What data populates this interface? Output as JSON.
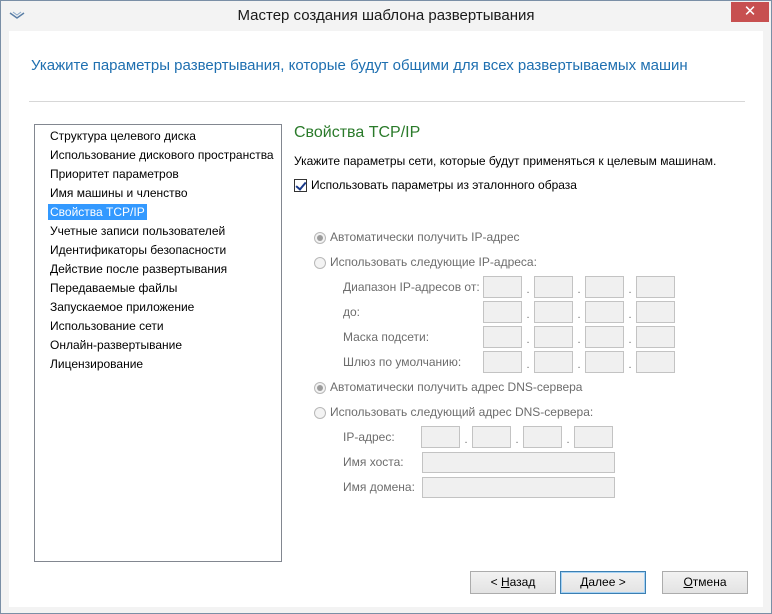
{
  "window": {
    "title": "Мастер создания шаблона развертывания",
    "close_label": "✕"
  },
  "header": {
    "text": "Укажите параметры развертывания, которые будут общими для всех развертываемых машин"
  },
  "nav": {
    "selected_index": 4,
    "items": [
      {
        "label": "Структура целевого диска"
      },
      {
        "label": "Использование дискового пространства"
      },
      {
        "label": "Приоритет параметров"
      },
      {
        "label": "Имя машины и членство"
      },
      {
        "label": "Свойства TCP/IP"
      },
      {
        "label": "Учетные записи пользователей"
      },
      {
        "label": "Идентификаторы безопасности"
      },
      {
        "label": "Действие после развертывания"
      },
      {
        "label": "Передаваемые файлы"
      },
      {
        "label": "Запускаемое приложение"
      },
      {
        "label": "Использование сети"
      },
      {
        "label": "Онлайн-развертывание"
      },
      {
        "label": "Лицензирование"
      }
    ]
  },
  "tcpip": {
    "title": "Свойства TCP/IP",
    "description": "Укажите параметры сети, которые будут применяться к целевым машинам.",
    "use_master_label": "Использовать параметры из эталонного образа",
    "use_master_checked": true,
    "ip_auto_label": "Автоматически получить IP-адрес",
    "ip_auto_checked": true,
    "ip_manual_label": "Использовать следующие IP-адреса:",
    "ip_manual_checked": false,
    "range_from_label": "Диапазон IP-адресов от:",
    "range_to_label": "до:",
    "subnet_label": "Маска подсети:",
    "gateway_label": "Шлюз по умолчанию:",
    "dns_auto_label": "Автоматически получить адрес DNS-сервера",
    "dns_auto_checked": true,
    "dns_manual_label": "Использовать следующий адрес DNS-сервера:",
    "dns_manual_checked": false,
    "dns_ip_label": "IP-адрес:",
    "hostname_label": "Имя хоста:",
    "domain_label": "Имя домена:",
    "ip_separator": "."
  },
  "buttons": {
    "back_prefix": "< ",
    "back_mnemonic": "Н",
    "back_rest": "азад",
    "next_label": "Далее >",
    "cancel_mnemonic": "О",
    "cancel_rest": "тмена"
  }
}
